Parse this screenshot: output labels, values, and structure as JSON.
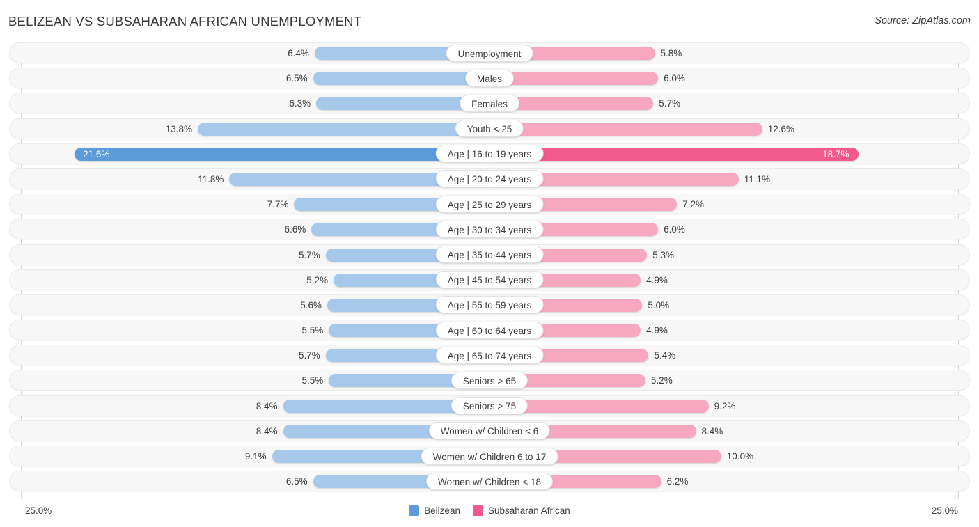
{
  "header": {
    "title": "BELIZEAN VS SUBSAHARAN AFRICAN UNEMPLOYMENT",
    "source": "Source: ZipAtlas.com"
  },
  "legend": {
    "left": {
      "label": "Belizean",
      "color": "#5b9bd9"
    },
    "right": {
      "label": "Subsaharan African",
      "color": "#f2598c"
    }
  },
  "axis": {
    "left_label": "25.0%",
    "right_label": "25.0%",
    "max": 25.0
  },
  "colors": {
    "left_bar": "#a6c8ea",
    "left_bar_high": "#5b9bd9",
    "right_bar": "#f7a8c0",
    "right_bar_high": "#f2598c",
    "track": "#f7f7f7",
    "grid": "#d9d9d9"
  },
  "chart_data": {
    "type": "bar",
    "orientation": "horizontal-diverging",
    "title": "BELIZEAN VS SUBSAHARAN AFRICAN UNEMPLOYMENT",
    "xlabel": "",
    "ylabel": "",
    "xlim": [
      25.0,
      25.0
    ],
    "grid": true,
    "legend_position": "bottom-center",
    "categories": [
      "Unemployment",
      "Males",
      "Females",
      "Youth < 25",
      "Age | 16 to 19 years",
      "Age | 20 to 24 years",
      "Age | 25 to 29 years",
      "Age | 30 to 34 years",
      "Age | 35 to 44 years",
      "Age | 45 to 54 years",
      "Age | 55 to 59 years",
      "Age | 60 to 64 years",
      "Age | 65 to 74 years",
      "Seniors > 65",
      "Seniors > 75",
      "Women w/ Children < 6",
      "Women w/ Children 6 to 17",
      "Women w/ Children < 18"
    ],
    "series": [
      {
        "name": "Belizean",
        "color": "#a6c8ea",
        "values": [
          6.4,
          6.5,
          6.3,
          13.8,
          21.6,
          11.8,
          7.7,
          6.6,
          5.7,
          5.2,
          5.6,
          5.5,
          5.7,
          5.5,
          8.4,
          8.4,
          9.1,
          6.5
        ],
        "labels": [
          "6.4%",
          "6.5%",
          "6.3%",
          "13.8%",
          "21.6%",
          "11.8%",
          "7.7%",
          "6.6%",
          "5.7%",
          "5.2%",
          "5.6%",
          "5.5%",
          "5.7%",
          "5.5%",
          "8.4%",
          "8.4%",
          "9.1%",
          "6.5%"
        ]
      },
      {
        "name": "Subsaharan African",
        "color": "#f7a8c0",
        "values": [
          5.8,
          6.0,
          5.7,
          12.6,
          18.7,
          11.1,
          7.2,
          6.0,
          5.3,
          4.9,
          5.0,
          4.9,
          5.4,
          5.2,
          9.2,
          8.4,
          10.0,
          6.2
        ],
        "labels": [
          "5.8%",
          "6.0%",
          "5.7%",
          "12.6%",
          "18.7%",
          "11.1%",
          "7.2%",
          "6.0%",
          "5.3%",
          "4.9%",
          "5.0%",
          "4.9%",
          "5.4%",
          "5.2%",
          "9.2%",
          "8.4%",
          "10.0%",
          "6.2%"
        ]
      }
    ],
    "highlighted_row": "Age | 16 to 19 years"
  }
}
